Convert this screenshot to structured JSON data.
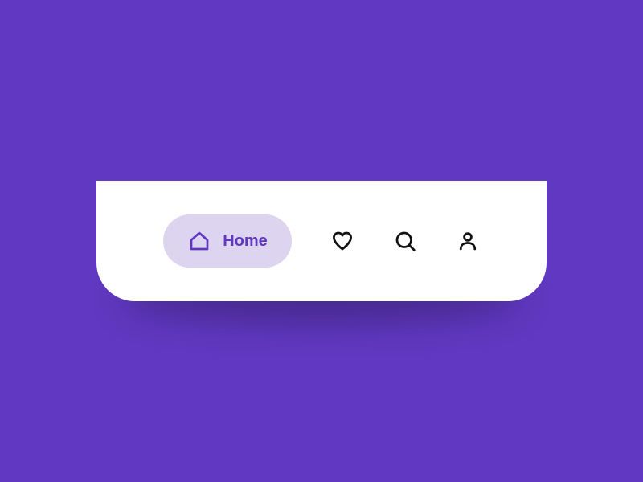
{
  "colors": {
    "background": "#6038c1",
    "nav_bg": "#ffffff",
    "active_bg": "#ddd4f0",
    "active_fg": "#6038c1",
    "icon_default": "#111111"
  },
  "nav": {
    "items": [
      {
        "id": "home",
        "label": "Home",
        "icon": "home-icon",
        "active": true
      },
      {
        "id": "favorites",
        "label": "Favorites",
        "icon": "heart-icon",
        "active": false
      },
      {
        "id": "search",
        "label": "Search",
        "icon": "search-icon",
        "active": false
      },
      {
        "id": "profile",
        "label": "Profile",
        "icon": "user-icon",
        "active": false
      }
    ]
  }
}
